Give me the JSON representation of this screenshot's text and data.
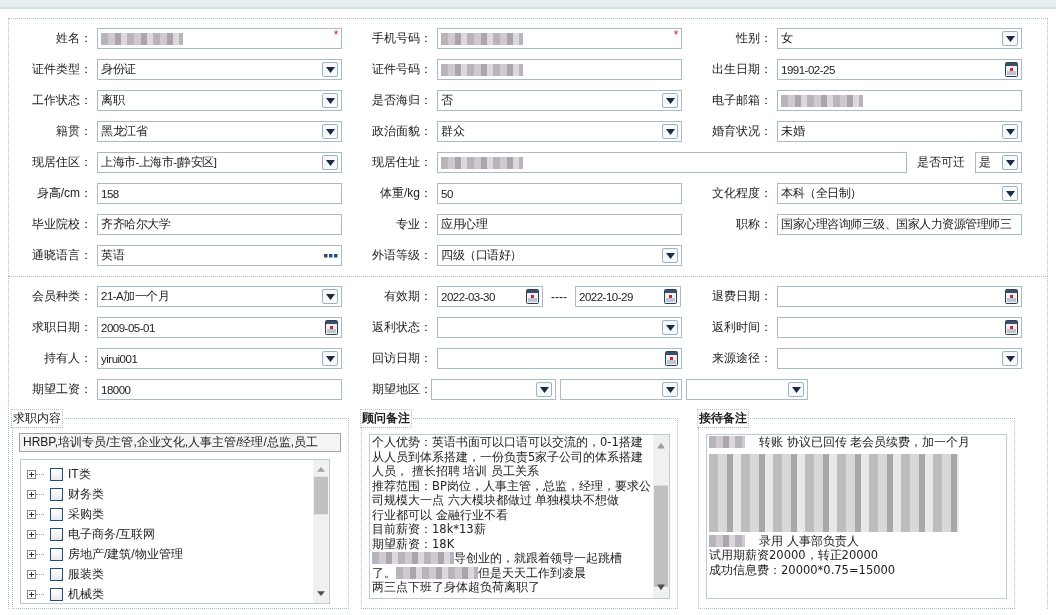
{
  "basic_info": {
    "rows": [
      [
        {
          "label": "姓名：",
          "kind": "text",
          "redacted": true,
          "required_mark": "*"
        },
        {
          "label": "手机号码：",
          "kind": "text",
          "redacted": true,
          "required_mark": "*"
        },
        {
          "label": "性别：",
          "kind": "select",
          "value": "女"
        }
      ],
      [
        {
          "label": "证件类型：",
          "kind": "select",
          "value": "身份证"
        },
        {
          "label": "证件号码：",
          "kind": "text",
          "redacted": true
        },
        {
          "label": "出生日期：",
          "kind": "date",
          "value": "1991-02-25"
        }
      ],
      [
        {
          "label": "工作状态：",
          "kind": "select",
          "value": "离职"
        },
        {
          "label": "是否海归：",
          "kind": "select",
          "value": "否"
        },
        {
          "label": "电子邮箱：",
          "kind": "text",
          "redacted": true
        }
      ],
      [
        {
          "label": "籍贯：",
          "kind": "select",
          "value": "黑龙江省"
        },
        {
          "label": "政治面貌：",
          "kind": "select",
          "value": "群众"
        },
        {
          "label": "婚育状况：",
          "kind": "select",
          "value": "未婚"
        }
      ],
      [
        {
          "label": "现居住区：",
          "kind": "select",
          "value": "上海市-上海市-[静安区]"
        },
        {
          "label": "现居住址：",
          "kind": "address",
          "redacted": true,
          "extra_label": "是否可迁",
          "extra_value": "是"
        }
      ],
      [
        {
          "label": "身高/cm：",
          "kind": "text",
          "value": "158"
        },
        {
          "label": "体重/kg：",
          "kind": "text",
          "value": "50"
        },
        {
          "label": "文化程度：",
          "kind": "select",
          "value": "本科（全日制）"
        }
      ],
      [
        {
          "label": "毕业院校：",
          "kind": "text",
          "value": "齐齐哈尔大学"
        },
        {
          "label": "专业：",
          "kind": "text",
          "value": "应用心理"
        },
        {
          "label": "职称：",
          "kind": "text",
          "value": "国家心理咨询师三级、国家人力资源管理师三"
        }
      ],
      [
        {
          "label": "通晓语言：",
          "kind": "lookup",
          "value": "英语"
        },
        {
          "label": "外语等级：",
          "kind": "select",
          "value": "四级（口语好）"
        }
      ]
    ]
  },
  "membership": {
    "rows": [
      [
        {
          "label": "会员种类：",
          "kind": "select",
          "value": "21-A加一个月"
        },
        {
          "label": "有效期：",
          "kind": "date_range",
          "values": [
            "2022-03-30",
            "2022-10-29"
          ],
          "separator": "----"
        },
        {
          "label": "退费日期：",
          "kind": "date"
        }
      ],
      [
        {
          "label": "求职日期：",
          "kind": "date",
          "value": "2009-05-01"
        },
        {
          "label": "返利状态：",
          "kind": "select"
        },
        {
          "label": "返利时间：",
          "kind": "date"
        }
      ],
      [
        {
          "label": "持有人：",
          "kind": "select",
          "value": "yirui001"
        },
        {
          "label": "回访日期：",
          "kind": "date"
        },
        {
          "label": "来源途径：",
          "kind": "select"
        }
      ],
      [
        {
          "label": "期望工资：",
          "kind": "text",
          "value": "18000"
        },
        {
          "label": "期望地区：",
          "kind": "region",
          "selects": [
            {
              "kind": "select"
            },
            {
              "kind": "select"
            },
            {
              "kind": "select"
            }
          ]
        }
      ]
    ]
  },
  "job_intent": {
    "title": "求职内容",
    "value": "HRBP,培训专员/主管,企业文化,人事主管/经理/总监,员工",
    "items": [
      {
        "label": "IT类",
        "expanded": false,
        "checked": false
      },
      {
        "label": "财务类",
        "expanded": false,
        "checked": false
      },
      {
        "label": "采购类",
        "expanded": false,
        "checked": false
      },
      {
        "label": "电子商务/互联网",
        "expanded": false,
        "checked": false
      },
      {
        "label": "房地产/建筑/物业管理",
        "expanded": false,
        "checked": false
      },
      {
        "label": "服装类",
        "expanded": false,
        "checked": false
      },
      {
        "label": "机械类",
        "expanded": false,
        "checked": false
      }
    ]
  },
  "consultant_notes": {
    "title": "顾问备注",
    "lines": [
      [
        {
          "kind": "text",
          "text": "个人优势：英语书面可以口语可以交流的，0-1搭建"
        }
      ],
      [
        {
          "kind": "text",
          "text": "从人员到体系搭建，一份负责5家子公司的体系搭建"
        }
      ],
      [
        {
          "kind": "text",
          "text": "人员， 擅长招聘 培训 员工关系"
        }
      ],
      [
        {
          "kind": "text",
          "text": "推荐范围：BP岗位，人事主管，总监，经理，要求公"
        }
      ],
      [
        {
          "kind": "text",
          "text": "司规模大一点 六大模块都做过 单独模块不想做"
        }
      ],
      [
        {
          "kind": "text",
          "text": "行业都可以  金融行业不看"
        }
      ],
      [
        {
          "kind": "text",
          "text": "目前薪资：18k*13薪"
        }
      ],
      [
        {
          "kind": "text",
          "text": "期望薪资：18K"
        }
      ],
      [
        {
          "kind": "blur"
        },
        {
          "kind": "text",
          "text": "导创业的，就跟着领导一起跳槽"
        }
      ],
      [
        {
          "kind": "text",
          "text": "了。"
        },
        {
          "kind": "blur"
        },
        {
          "kind": "text",
          "text": "但是天天工作到凌晨"
        }
      ],
      [
        {
          "kind": "text",
          "text": "两三点下班了身体超负荷离职了"
        }
      ]
    ]
  },
  "reception_notes": {
    "title": "接待备注",
    "lines": [
      [
        {
          "kind": "blur_short"
        },
        {
          "kind": "text",
          "text": "转账  协议已回传  老会员续费，加一个月"
        }
      ],
      [
        {
          "kind": "blur_block"
        }
      ],
      [
        {
          "kind": "blur_short"
        },
        {
          "kind": "text",
          "text": "录用 人事部负责人"
        }
      ],
      [
        {
          "kind": "text",
          "text": "试用期薪资20000，转正20000"
        }
      ],
      [
        {
          "kind": "text",
          "text": "成功信息费：20000*0.75=15000"
        }
      ]
    ]
  }
}
